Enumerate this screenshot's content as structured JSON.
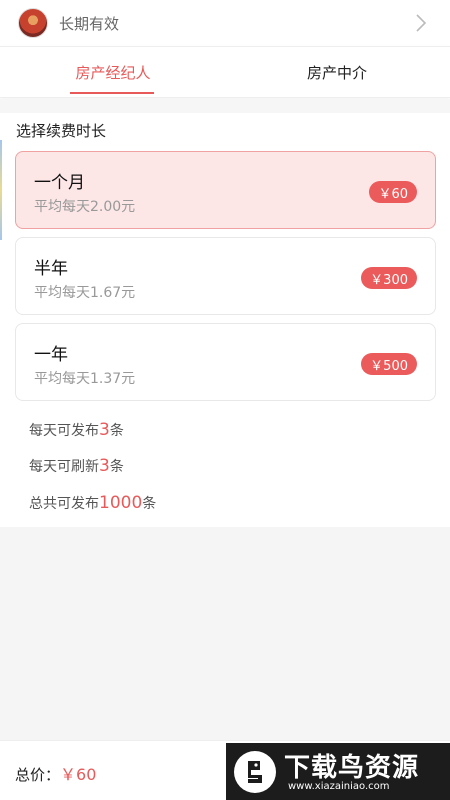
{
  "header": {
    "validity_text": "长期有效"
  },
  "tabs": [
    {
      "label": "房产经纪人",
      "active": true
    },
    {
      "label": "房产中介",
      "active": false
    }
  ],
  "section_title": "选择续费时长",
  "plans": [
    {
      "name": "一个月",
      "avg": "平均每天2.00元",
      "price": "￥60",
      "selected": true
    },
    {
      "name": "半年",
      "avg": "平均每天1.67元",
      "price": "￥300",
      "selected": false
    },
    {
      "name": "一年",
      "avg": "平均每天1.37元",
      "price": "￥500",
      "selected": false
    }
  ],
  "perks": [
    {
      "prefix": "每天可发布",
      "num": "3",
      "suffix": "条"
    },
    {
      "prefix": "每天可刷新",
      "num": "3",
      "suffix": "条"
    },
    {
      "prefix": "总共可发布",
      "num": "1000",
      "suffix": "条"
    }
  ],
  "footer": {
    "total_label": "总价：",
    "total_amount": "￥60"
  },
  "watermark": {
    "title": "下载鸟资源",
    "url": "www.xiazainiao.com"
  },
  "colors": {
    "accent": "#e85a5a",
    "selected_bg": "#fde6e6",
    "badge": "#ec5b5b"
  },
  "icons": {
    "chevron": "chevron-right-icon",
    "avatar": "avatar"
  }
}
